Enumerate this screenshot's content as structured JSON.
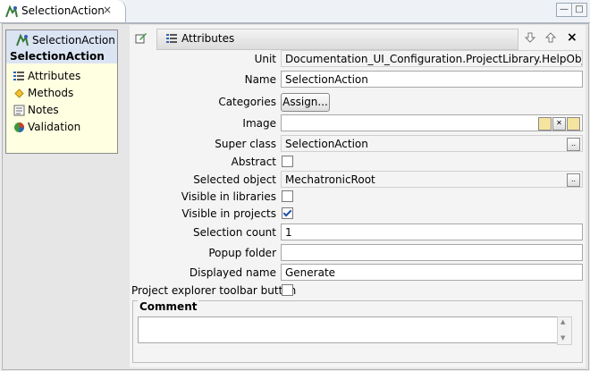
{
  "tab": {
    "title": "SelectionAction",
    "close_icon": "×"
  },
  "window": {
    "minimize": "—",
    "maximize": "□"
  },
  "outline": {
    "root_label": "SelectionAction",
    "selected_label": "SelectionAction",
    "items": [
      {
        "label": "Attributes",
        "icon": "list-icon"
      },
      {
        "label": "Methods",
        "icon": "diamond-icon"
      },
      {
        "label": "Notes",
        "icon": "notes-icon"
      },
      {
        "label": "Validation",
        "icon": "validation-icon"
      }
    ]
  },
  "section": {
    "title": "Attributes",
    "close": "×"
  },
  "form": {
    "unit_label": "Unit",
    "unit_value": "Documentation_UI_Configuration.ProjectLibrary.HelpObjects",
    "name_label": "Name",
    "name_value": "SelectionAction",
    "categories_label": "Categories",
    "assign_button": "Assign...",
    "image_label": "Image",
    "image_value": "",
    "superclass_label": "Super class",
    "superclass_value": "SelectionAction",
    "abstract_label": "Abstract",
    "abstract_checked": false,
    "selected_object_label": "Selected object",
    "selected_object_value": "MechatronicRoot",
    "visible_libraries_label": "Visible in libraries",
    "visible_libraries_checked": false,
    "visible_projects_label": "Visible in projects",
    "visible_projects_checked": true,
    "selection_count_label": "Selection count",
    "selection_count_value": "1",
    "popup_folder_label": "Popup folder",
    "popup_folder_value": "",
    "displayed_name_label": "Displayed name",
    "displayed_name_value": "Generate",
    "toolbar_button_label": "Project explorer toolbar button",
    "toolbar_button_checked": false,
    "browse_button": "..",
    "comment_label": "Comment",
    "comment_value": ""
  }
}
